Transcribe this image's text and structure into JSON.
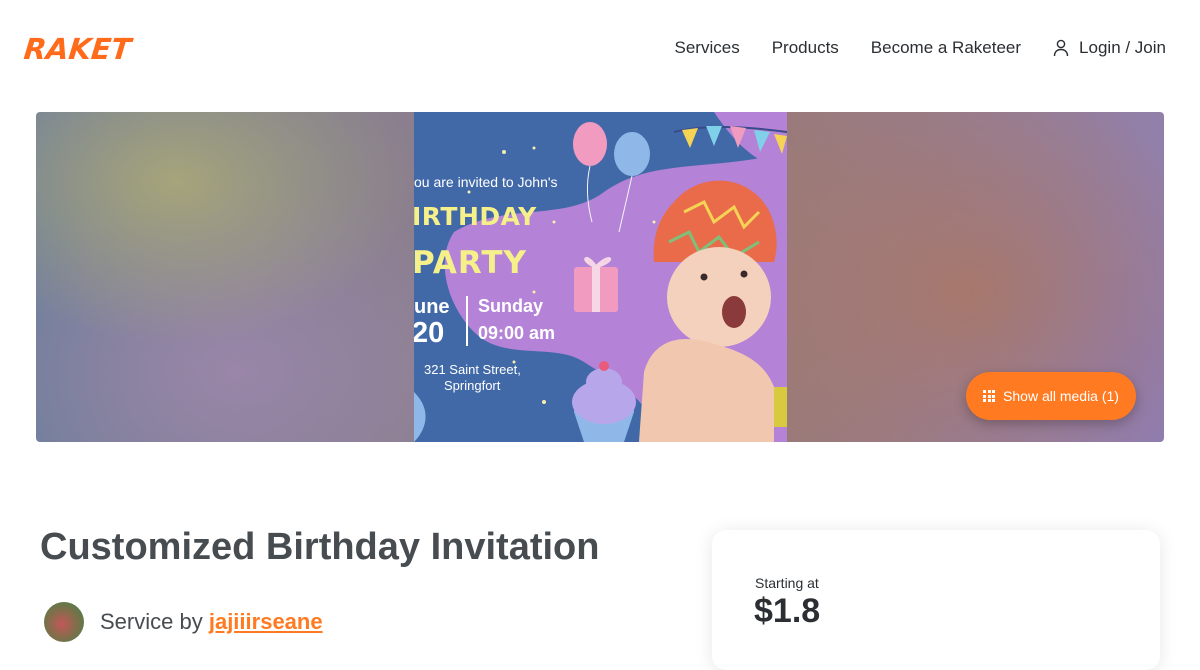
{
  "header": {
    "logo": "RAKET",
    "nav": {
      "services": "Services",
      "products": "Products",
      "become": "Become a Raketeer",
      "login": "Login / Join"
    }
  },
  "hero": {
    "poster": {
      "invite_line": "ou are invited to John's",
      "birthday": "IRTHDAY",
      "party": "PARTY",
      "month": "une",
      "day": "20",
      "weekday": "Sunday",
      "time": "09:00 am",
      "street": "321 Saint Street,",
      "city": "Springfort"
    },
    "media_button": "Show all media (1)"
  },
  "listing": {
    "title": "Customized Birthday Invitation",
    "service_by": "Service by",
    "seller_name": "jajiiirseane"
  },
  "pricing": {
    "label": "Starting at",
    "price": "$1.8"
  },
  "colors": {
    "brand": "#ff7a21",
    "text": "#2b2f33",
    "title": "#474c51"
  }
}
